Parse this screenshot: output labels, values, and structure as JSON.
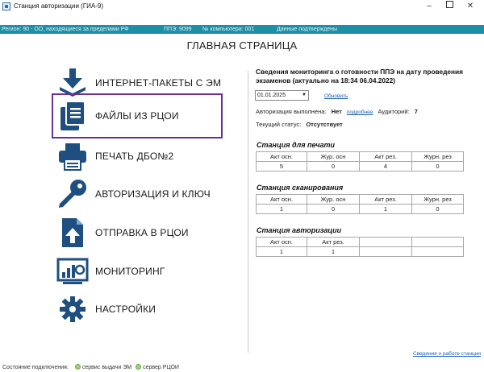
{
  "window": {
    "title": "Станция авторизации (ГИА-9)",
    "min": "–",
    "close": "✕"
  },
  "infobar": {
    "region": "Регион: 90 - ОО, находящиеся за пределами РФ",
    "ppe": "ППЭ: 9099",
    "computer": "№ компьютера: 001",
    "status": "Данные подтверждены"
  },
  "page_title": "ГЛАВНАЯ СТРАНИЦА",
  "menu": [
    {
      "label": "ИНТЕРНЕТ-ПАКЕТЫ С ЭМ",
      "icon": "download-icon"
    },
    {
      "label": "ФАЙЛЫ ИЗ РЦОИ",
      "icon": "files-icon",
      "active": true
    },
    {
      "label": "ПЕЧАТЬ ДБО№2",
      "icon": "printer-icon"
    },
    {
      "label": "АВТОРИЗАЦИЯ И КЛЮЧ",
      "icon": "key-icon"
    },
    {
      "label": "ОТПРАВКА В РЦОИ",
      "icon": "upload-file-icon"
    },
    {
      "label": "МОНИТОРИНГ",
      "icon": "monitoring-icon"
    },
    {
      "label": "НАСТРОЙКИ",
      "icon": "settings-icon"
    }
  ],
  "monitoring": {
    "title": "Сведения мониторинга о готовности ППЭ на дату проведения экзаменов (актуально на 18:34 06.04.2022)",
    "date": "01.01.2025",
    "refresh": "Обновить",
    "auth_label": "Авторизация выполнена:",
    "auth_value": "Нет",
    "details": "подробнее",
    "auditoriums_label": "Аудиторий:",
    "auditoriums_value": "7",
    "status_label": "Текущий статус:",
    "status_value": "Отсутствует"
  },
  "stations": [
    {
      "title": "Станция для печати",
      "headers": [
        "Акт осн.",
        "Жур. осн",
        "Акт рез.",
        "Журн. рез"
      ],
      "values": [
        "5",
        "0",
        "4",
        "0"
      ]
    },
    {
      "title": "Станция сканирования",
      "headers": [
        "Акт осн.",
        "Жур. осн",
        "Акт рез.",
        "Журн. рез"
      ],
      "values": [
        "1",
        "0",
        "1",
        "0"
      ]
    },
    {
      "title": "Станция авторизации",
      "headers": [
        "Акт осн.",
        "Акт рез.",
        "",
        ""
      ],
      "values": [
        "1",
        "1",
        "",
        ""
      ]
    }
  ],
  "footer_link": "Сведения о работе станции",
  "statusbar": {
    "label": "Состояние подключения:",
    "service": "сервис выдачи ЭМ",
    "server": "сервер РЦОИ"
  }
}
